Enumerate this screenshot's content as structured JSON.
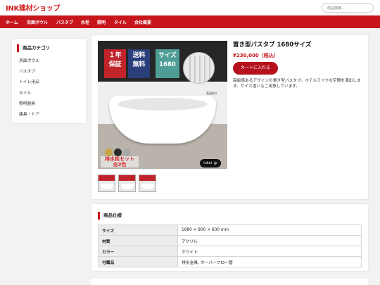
{
  "header": {
    "logo": "INK建材ショップ",
    "search_placeholder": "商品検索..."
  },
  "nav": {
    "items": [
      "ホーム",
      "洗面ボウル",
      "バスタブ",
      "水栓",
      "照明",
      "タイル",
      "会社概要"
    ]
  },
  "sidebar": {
    "title": "商品カテゴリ",
    "items": [
      "洗面ボウル",
      "バスタブ",
      "トイレ用品",
      "タイル",
      "照明器具",
      "建具・ドア"
    ]
  },
  "product": {
    "title": "置き型バスタブ 1680サイズ",
    "price": "¥230,000（税込）",
    "cart_button": "カートに入れる",
    "description": "高級感あるデザインの置き型バスタブ。ホテルライクな空間を演出します。サイズ違いもご用意しています。",
    "image_badges": [
      {
        "line1": "１年",
        "line2": "保証"
      },
      {
        "line1": "送料",
        "line2": "無料"
      },
      {
        "line1": "サイズ",
        "line2": "1680"
      }
    ],
    "zoom_label": "表面拡大",
    "drain_label": {
      "line1": "排水栓セット",
      "line2": "全3色"
    },
    "brand_badge": "inkei. jp",
    "accent_color": "#c8141b"
  },
  "specs": {
    "title": "商品仕様",
    "rows": [
      {
        "key": "サイズ",
        "value": "1680 × 800 × 600 mm"
      },
      {
        "key": "材質",
        "value": "アクリル"
      },
      {
        "key": "カラー",
        "value": "ホワイト"
      },
      {
        "key": "付属品",
        "value": "排水金具, オーバーフロー管"
      }
    ]
  }
}
